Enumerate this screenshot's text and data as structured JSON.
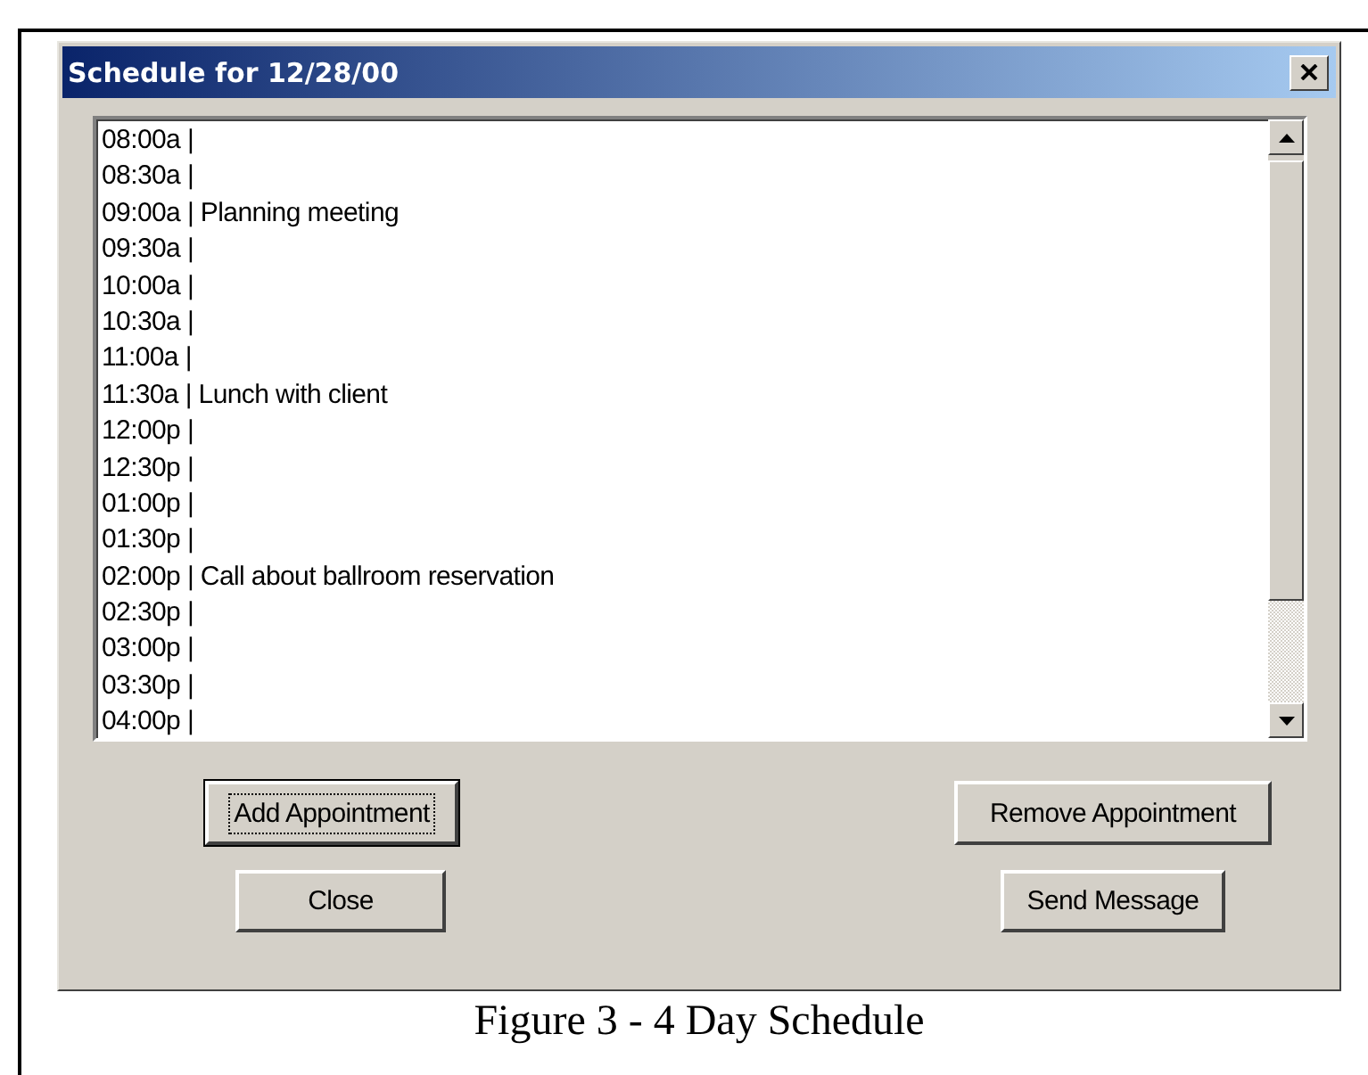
{
  "window": {
    "title": "Schedule for 12/28/00"
  },
  "schedule": [
    "08:00a |",
    "08:30a |",
    "09:00a | Planning meeting",
    "09:30a |",
    "10:00a |",
    "10:30a |",
    "11:00a |",
    "11:30a | Lunch with client",
    "12:00p |",
    "12:30p |",
    "01:00p |",
    "01:30p |",
    "02:00p | Call about ballroom reservation",
    "02:30p |",
    "03:00p |",
    "03:30p |",
    "04:00p |"
  ],
  "buttons": [
    {
      "label": "Add Appointment",
      "focused": true
    },
    {
      "label": "Remove Appointment",
      "focused": false
    },
    {
      "label": "Close",
      "focused": false
    },
    {
      "label": "Send Message",
      "focused": false
    }
  ],
  "caption": "Figure 3 - 4  Day Schedule"
}
